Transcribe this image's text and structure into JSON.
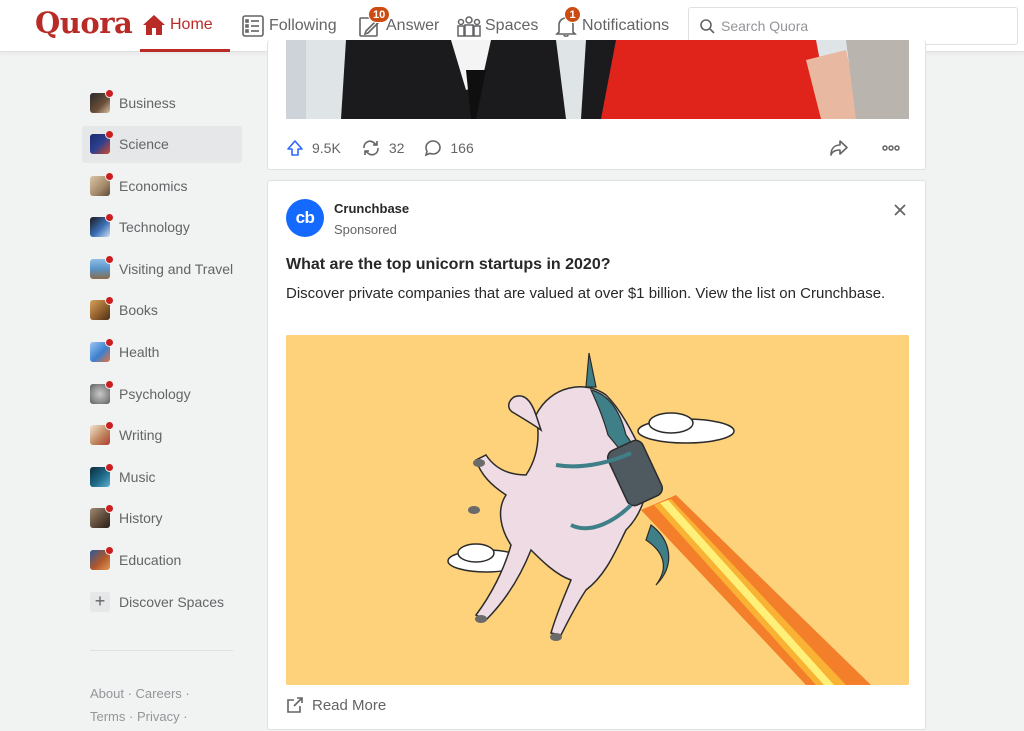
{
  "header": {
    "logo": "Quora",
    "nav": [
      {
        "label": "Home",
        "icon": "home-icon",
        "active": true
      },
      {
        "label": "Following",
        "icon": "following-icon"
      },
      {
        "label": "Answer",
        "icon": "answer-icon",
        "badge": "10"
      },
      {
        "label": "Spaces",
        "icon": "spaces-icon"
      },
      {
        "label": "Notifications",
        "icon": "bell-icon",
        "badge": "1"
      }
    ],
    "search_placeholder": "Search Quora"
  },
  "sidebar": {
    "items": [
      {
        "label": "Business",
        "color": "#6b4f3a"
      },
      {
        "label": "Science",
        "color": "#2d3f8f",
        "active": true
      },
      {
        "label": "Economics",
        "color": "#a48868"
      },
      {
        "label": "Technology",
        "color": "#3b6fb6"
      },
      {
        "label": "Visiting and Travel",
        "color": "#5a93c6"
      },
      {
        "label": "Books",
        "color": "#8a5a2b"
      },
      {
        "label": "Health",
        "color": "#3c7fd0"
      },
      {
        "label": "Psychology",
        "color": "#8c8c8c"
      },
      {
        "label": "Writing",
        "color": "#c08860"
      },
      {
        "label": "Music",
        "color": "#1f6b8a"
      },
      {
        "label": "History",
        "color": "#5e4a3a"
      },
      {
        "label": "Education",
        "color": "#b0572b"
      }
    ],
    "discover_label": "Discover Spaces",
    "footer": [
      "About",
      "Careers",
      "Terms",
      "Privacy"
    ]
  },
  "post": {
    "upvotes": "9.5K",
    "shares": "32",
    "comments": "166"
  },
  "ad": {
    "logo_text": "cb",
    "advertiser": "Crunchbase",
    "sponsored": "Sponsored",
    "title": "What are the top unicorn startups in 2020?",
    "description": "Discover private companies that are valued at over $1 billion. View the list on Crunchbase.",
    "read_more": "Read More"
  },
  "colors": {
    "brand": "#b92b27",
    "badge": "#cb4b10",
    "ad_image_bg": "#fdd27b",
    "crunchbase_blue": "#146aff"
  }
}
